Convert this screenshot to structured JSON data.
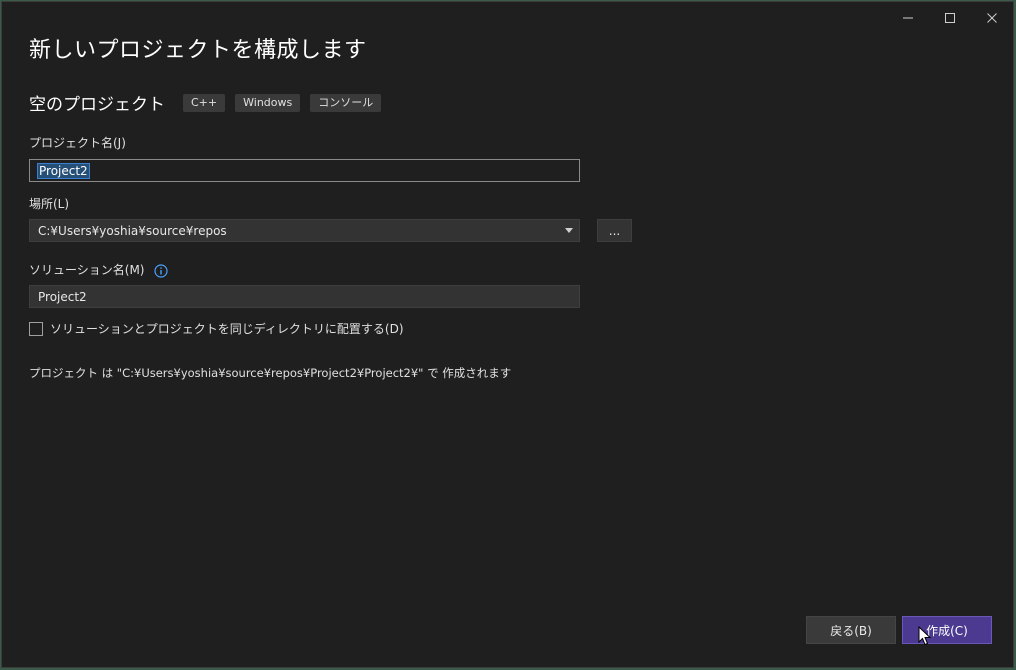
{
  "dialog": {
    "heading": "新しいプロジェクトを構成します",
    "template_name": "空のプロジェクト",
    "tags": [
      "C++",
      "Windows",
      "コンソール"
    ],
    "window_controls": {
      "minimize": "minimize-icon",
      "maximize": "maximize-icon",
      "close": "close-icon"
    }
  },
  "form": {
    "project_name_label": "プロジェクト名(J)",
    "project_name_value": "Project2",
    "location_label": "場所(L)",
    "location_value": "C:¥Users¥yoshia¥source¥repos",
    "browse_label": "...",
    "solution_name_label": "ソリューション名(M)",
    "solution_name_value": "Project2",
    "same_dir_checkbox_label": "ソリューションとプロジェクトを同じディレクトリに配置する(D)",
    "same_dir_checked": false,
    "creation_info": "プロジェクト は \"C:¥Users¥yoshia¥source¥repos¥Project2¥Project2¥\" で 作成されます"
  },
  "footer": {
    "back_label": "戻る(B)",
    "create_label": "作成(C)"
  },
  "colors": {
    "accent": "#4b3a8f",
    "background": "#1f1f1f",
    "selection": "#264f78"
  }
}
